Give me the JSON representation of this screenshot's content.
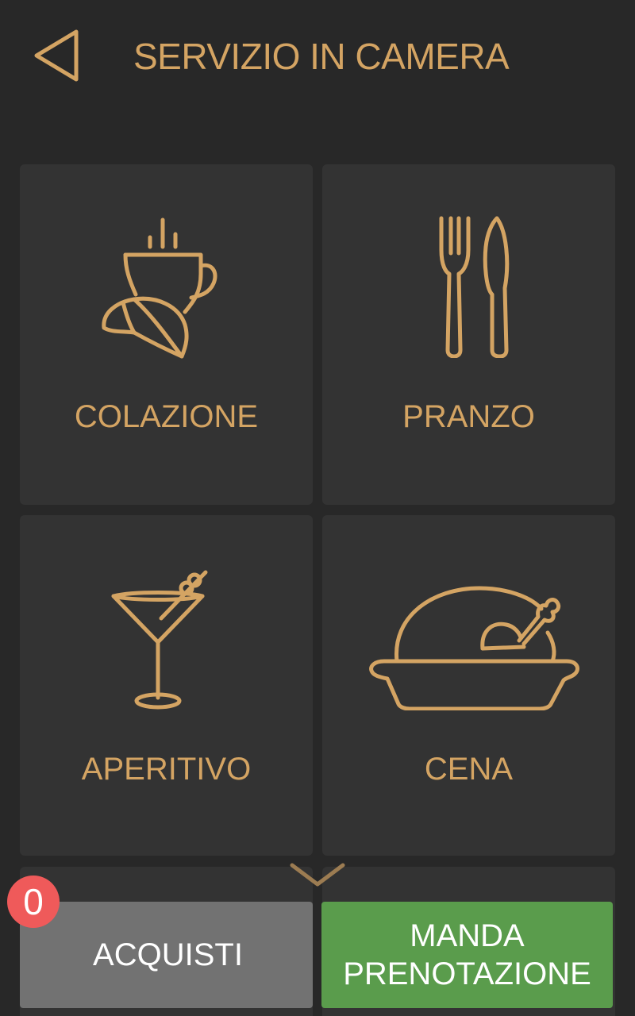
{
  "header": {
    "title": "SERVIZIO IN CAMERA",
    "back_icon": "back-triangle-icon"
  },
  "categories": [
    {
      "label": "COLAZIONE",
      "icon": "coffee-croissant-icon"
    },
    {
      "label": "PRANZO",
      "icon": "fork-knife-icon"
    },
    {
      "label": "APERITIVO",
      "icon": "cocktail-glass-icon"
    },
    {
      "label": "CENA",
      "icon": "roast-chicken-icon"
    }
  ],
  "scroll_hint_icon": "chevron-down-icon",
  "footer": {
    "cart_count": "0",
    "cart_label": "ACQUISTI",
    "send_label_line1": "MANDA",
    "send_label_line2": "PRENOTAZIONE"
  },
  "colors": {
    "background": "#282828",
    "tile": "#333333",
    "accent_gold": "#d4a463",
    "cart_button": "#727272",
    "send_button": "#5a9c4c",
    "badge": "#ef5a5a"
  }
}
